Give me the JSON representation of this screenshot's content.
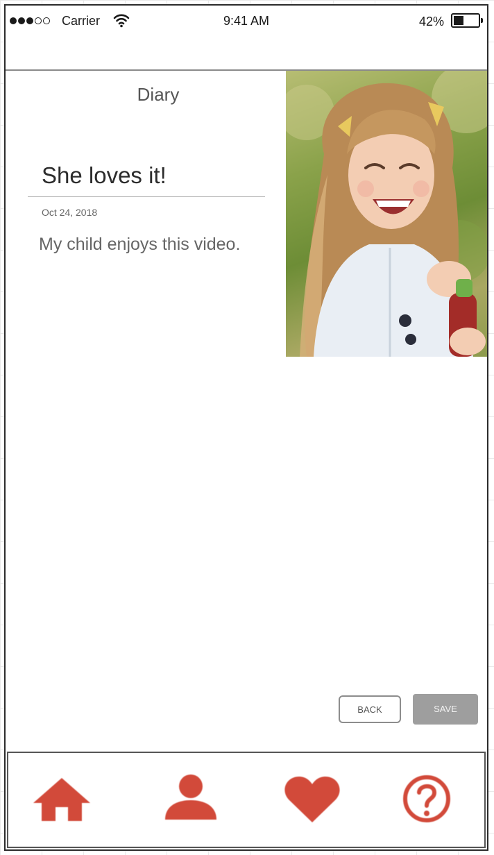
{
  "status_bar": {
    "carrier": "Carrier",
    "time": "9:41 AM",
    "battery_percent": "42%",
    "battery_level": 0.42,
    "signal_bars_filled": 3,
    "signal_bars_total": 5
  },
  "screen": {
    "title": "Diary"
  },
  "entry": {
    "title": "She loves it!",
    "date": "Oct 24, 2018",
    "body": "My child enjoys this video."
  },
  "actions": {
    "back_label": "BACK",
    "save_label": "SAVE"
  },
  "tab_bar": {
    "accent_color": "#d24a3a",
    "items": [
      {
        "icon": "home-icon"
      },
      {
        "icon": "person-icon"
      },
      {
        "icon": "heart-icon"
      },
      {
        "icon": "help-icon"
      }
    ]
  }
}
